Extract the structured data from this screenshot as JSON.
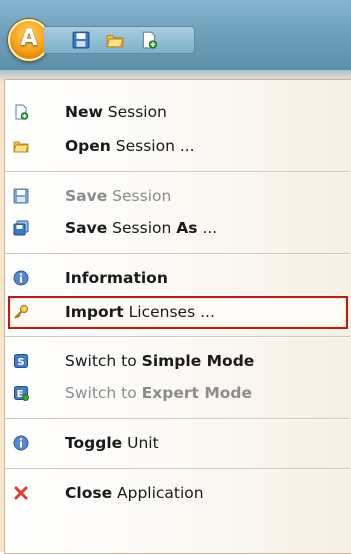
{
  "app": {
    "orb_letter": "A",
    "accent_color": "#f5a21a"
  },
  "quick_access": {
    "icons": [
      "save-icon",
      "open-folder-icon",
      "new-document-icon"
    ]
  },
  "menu": {
    "items": [
      {
        "bold": "New",
        "rest": " Session",
        "icon": "new-document-icon",
        "enabled": true
      },
      {
        "bold": "Open",
        "rest": " Session ...",
        "icon": "open-folder-icon",
        "enabled": true
      },
      {
        "bold": "Save",
        "rest": " Session",
        "icon": "save-icon",
        "enabled": false
      },
      {
        "bold": "Save",
        "rest": " Session ",
        "bold2": "As",
        "rest2": " ...",
        "icon": "save-as-icon",
        "enabled": true
      },
      {
        "bold": "Information",
        "rest": "",
        "icon": "info-icon",
        "enabled": true
      },
      {
        "bold": "Import",
        "rest": " Licenses ...",
        "icon": "key-icon",
        "enabled": true,
        "selected": true
      },
      {
        "pre": "Switch to ",
        "bold": "Simple Mode",
        "icon": "simple-mode-icon",
        "enabled": true
      },
      {
        "pre": "Switch to ",
        "bold": "Expert Mode",
        "icon": "expert-mode-icon",
        "enabled": false
      },
      {
        "bold": "Toggle",
        "rest": " Unit",
        "icon": "info-icon",
        "enabled": true
      },
      {
        "bold": "Close",
        "rest": " Application",
        "icon": "close-icon",
        "enabled": true
      }
    ]
  }
}
